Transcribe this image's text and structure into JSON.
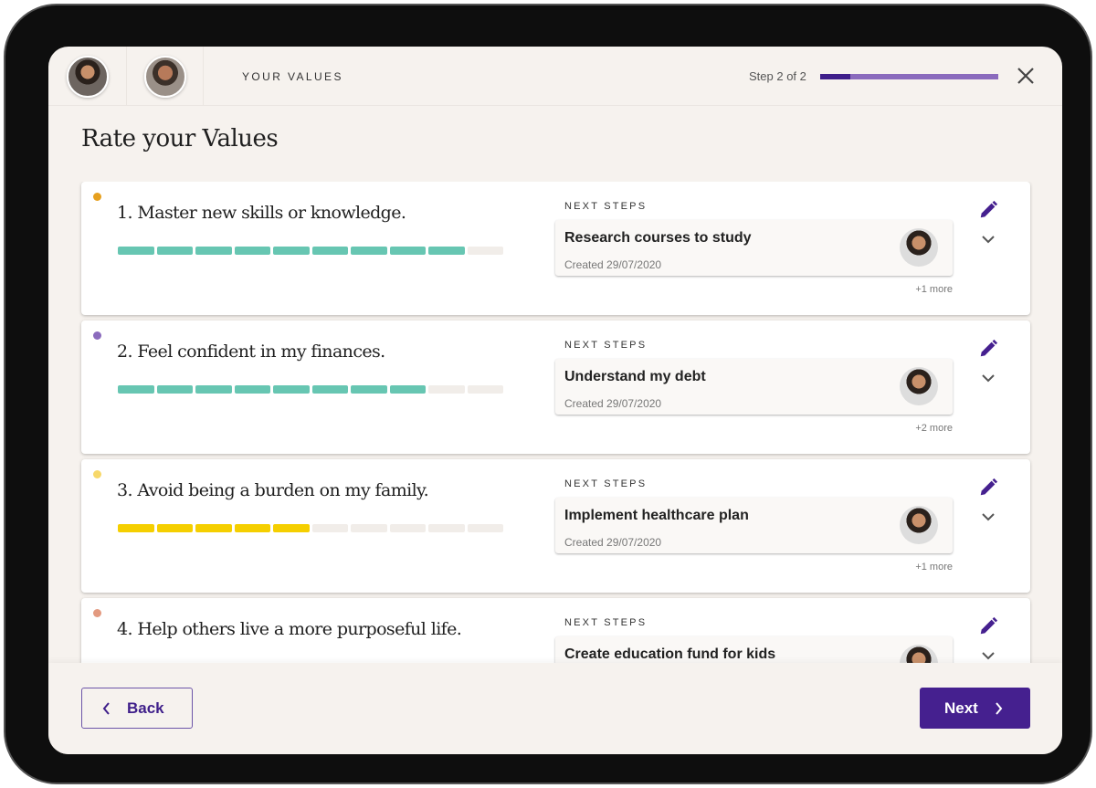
{
  "header": {
    "section_label": "YOUR VALUES",
    "step_text": "Step 2 of 2",
    "step_progress": 0.17,
    "avatars": [
      "user-avatar-1",
      "user-avatar-2"
    ]
  },
  "page_title": "Rate your Values",
  "colors": {
    "accent": "#45208f",
    "progress_dark": "#3f1f8a",
    "progress_light": "#8b6bbd",
    "rating_teal": "#67c6b2",
    "rating_yellow": "#f5cf00",
    "segment_empty": "#f1ede9"
  },
  "next_steps_label": "NEXT STEPS",
  "values": [
    {
      "title": "1. Master new skills or knowledge.",
      "dot_color": "#e6a01f",
      "rating": 9,
      "max": 10,
      "bar_color": "#67c6b2",
      "next_step": "Research courses to study",
      "created": "Created 29/07/2020",
      "more": "+1 more"
    },
    {
      "title": "2. Feel confident in my finances.",
      "dot_color": "#8b6bbd",
      "rating": 8,
      "max": 10,
      "bar_color": "#67c6b2",
      "next_step": "Understand my debt",
      "created": "Created 29/07/2020",
      "more": "+2 more"
    },
    {
      "title": "3. Avoid being a burden on my family.",
      "dot_color": "#f7d86a",
      "rating": 5,
      "max": 10,
      "bar_color": "#f5cf00",
      "next_step": "Implement healthcare plan",
      "created": "Created 29/07/2020",
      "more": "+1 more"
    },
    {
      "title": "4. Help others live a more purposeful life.",
      "dot_color": "#e39a80",
      "rating": null,
      "max": 10,
      "bar_color": "#67c6b2",
      "next_step": "Create education fund for kids",
      "created": "",
      "more": ""
    }
  ],
  "footer": {
    "back_label": "Back",
    "next_label": "Next"
  }
}
